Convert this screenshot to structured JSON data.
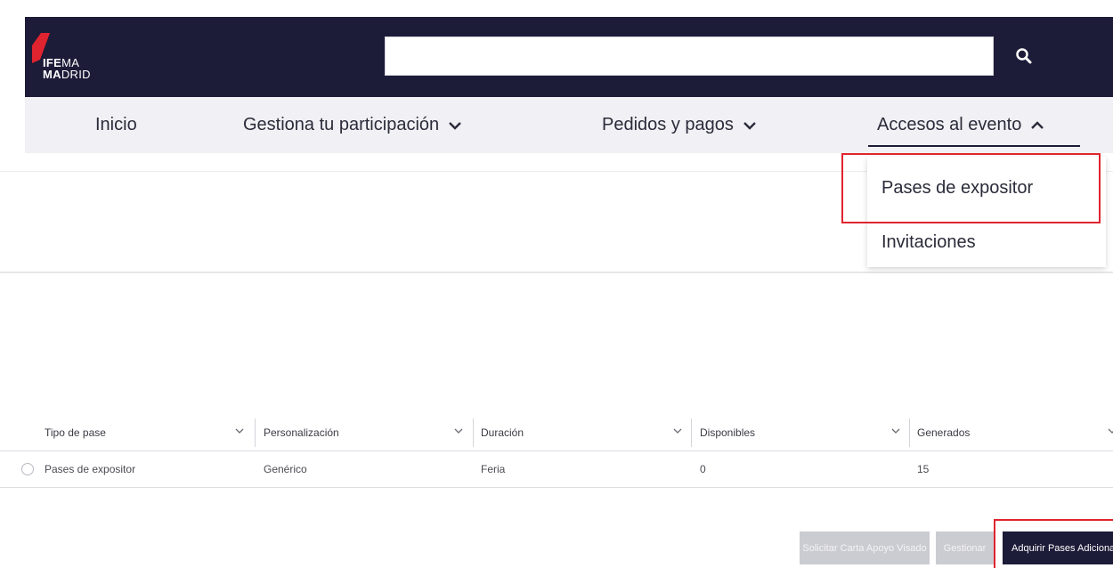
{
  "brand": {
    "logo_line1_bold": "IFE",
    "logo_line1_rest": "MA",
    "logo_line2_bold": "MA",
    "logo_line2_rest": "DRID",
    "accent_color": "#e0242f",
    "navy_color": "#1c1b38"
  },
  "search": {
    "value": "",
    "placeholder": "",
    "icon": "search-icon"
  },
  "nav": {
    "items": [
      {
        "label": "Inicio"
      },
      {
        "label": "Gestiona tu participación",
        "icon": "chevron-down-icon"
      },
      {
        "label": "Pedidos y pagos",
        "icon": "chevron-down-icon"
      },
      {
        "label": "Accesos al evento",
        "icon": "chevron-up-icon",
        "active": true
      }
    ]
  },
  "dropdown": {
    "items": [
      {
        "label": "Pases de expositor",
        "highlighted": true
      },
      {
        "label": "Invitaciones"
      }
    ]
  },
  "table": {
    "headers": [
      "Tipo de pase",
      "Personalización",
      "Duración",
      "Disponibles",
      "Generados"
    ],
    "rows": [
      {
        "cells": [
          "Pases de expositor",
          "Genérico",
          "Feria",
          "0",
          "15"
        ]
      }
    ]
  },
  "actions": {
    "solicitar_label": "Solicitar Carta Apoyo Visado",
    "gestionar_label": "Gestionar",
    "adquirir_label": "Adquirir Pases Adicionales"
  }
}
